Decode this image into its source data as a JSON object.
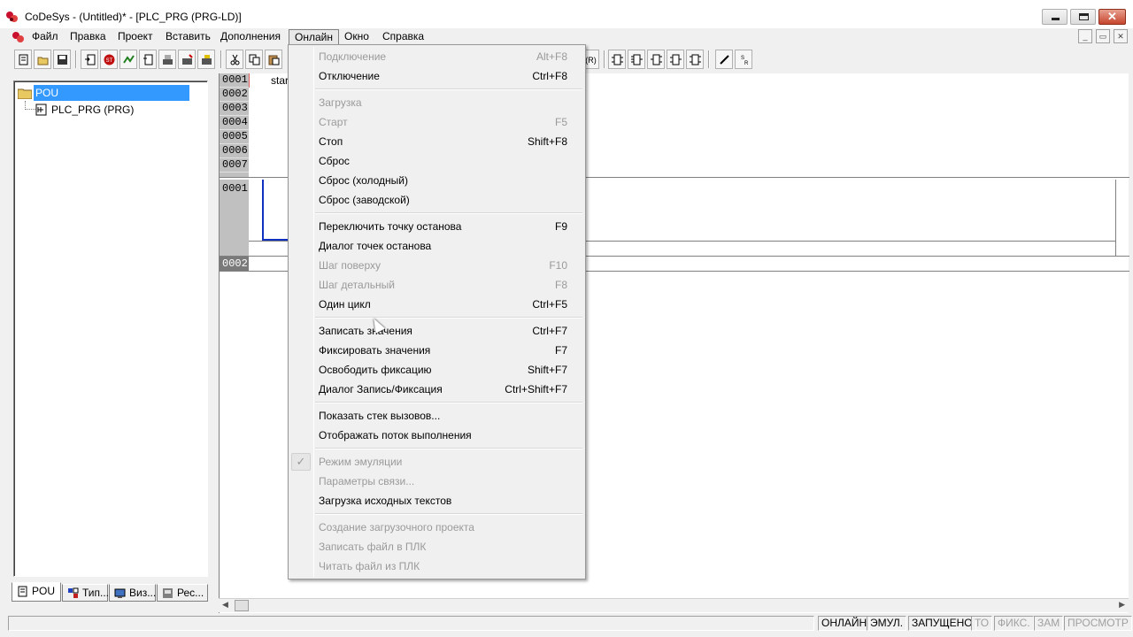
{
  "window": {
    "title": "CoDeSys - (Untitled)* - [PLC_PRG (PRG-LD)]"
  },
  "menubar": {
    "items": [
      "Файл",
      "Правка",
      "Проект",
      "Вставить",
      "Дополнения",
      "Онлайн",
      "Окно",
      "Справка"
    ],
    "active": "Онлайн"
  },
  "tree": {
    "root": "POU",
    "child": "PLC_PRG (PRG)"
  },
  "tabs": [
    "POU",
    "Тип...",
    "Виз...",
    "Рес..."
  ],
  "editor": {
    "decl_lines": [
      "0001",
      "0002",
      "0003",
      "0004",
      "0005",
      "0006",
      "0007"
    ],
    "decl_text": "star",
    "networks": [
      "0001",
      "0002"
    ]
  },
  "online_menu": [
    {
      "label": "Подключение",
      "shortcut": "Alt+F8",
      "disabled": true
    },
    {
      "label": "Отключение",
      "shortcut": "Ctrl+F8",
      "disabled": false
    },
    {
      "sep": true
    },
    {
      "label": "Загрузка",
      "shortcut": "",
      "disabled": true
    },
    {
      "label": "Старт",
      "shortcut": "F5",
      "disabled": true
    },
    {
      "label": "Стоп",
      "shortcut": "Shift+F8",
      "disabled": false
    },
    {
      "label": "Сброс",
      "shortcut": "",
      "disabled": false
    },
    {
      "label": "Сброс (холодный)",
      "shortcut": "",
      "disabled": false
    },
    {
      "label": "Сброс (заводской)",
      "shortcut": "",
      "disabled": false
    },
    {
      "sep": true
    },
    {
      "label": "Переключить точку останова",
      "shortcut": "F9",
      "disabled": false
    },
    {
      "label": "Диалог точек останова",
      "shortcut": "",
      "disabled": false
    },
    {
      "label": "Шаг поверху",
      "shortcut": "F10",
      "disabled": true
    },
    {
      "label": "Шаг детальный",
      "shortcut": "F8",
      "disabled": true
    },
    {
      "label": "Один цикл",
      "shortcut": "Ctrl+F5",
      "disabled": false
    },
    {
      "sep": true
    },
    {
      "label": "Записать значения",
      "shortcut": "Ctrl+F7",
      "disabled": false
    },
    {
      "label": "Фиксировать значения",
      "shortcut": "F7",
      "disabled": false
    },
    {
      "label": "Освободить фиксацию",
      "shortcut": "Shift+F7",
      "disabled": false
    },
    {
      "label": "Диалог Запись/Фиксация",
      "shortcut": "Ctrl+Shift+F7",
      "disabled": false
    },
    {
      "sep": true
    },
    {
      "label": "Показать стек вызовов...",
      "shortcut": "",
      "disabled": false
    },
    {
      "label": "Отображать поток выполнения",
      "shortcut": "",
      "disabled": false
    },
    {
      "sep": true
    },
    {
      "label": "Режим эмуляции",
      "shortcut": "",
      "disabled": true,
      "checked": true
    },
    {
      "label": "Параметры связи...",
      "shortcut": "",
      "disabled": true
    },
    {
      "label": "Загрузка исходных текстов",
      "shortcut": "",
      "disabled": false
    },
    {
      "sep": true
    },
    {
      "label": "Создание загрузочного проекта",
      "shortcut": "",
      "disabled": true
    },
    {
      "label": "Записать файл в ПЛК",
      "shortcut": "",
      "disabled": true
    },
    {
      "label": "Читать файл из ПЛК",
      "shortcut": "",
      "disabled": true
    }
  ],
  "status": [
    {
      "label": "ОНЛАЙН",
      "on": true
    },
    {
      "label": "ЭМУЛ.",
      "on": true
    },
    {
      "label": "ЗАПУЩЕНО",
      "on": true
    },
    {
      "label": "ТО",
      "on": false
    },
    {
      "label": "ФИКС.",
      "on": false
    },
    {
      "label": "ЗАМ",
      "on": false
    },
    {
      "label": "ПРОСМОТР",
      "on": false
    }
  ]
}
